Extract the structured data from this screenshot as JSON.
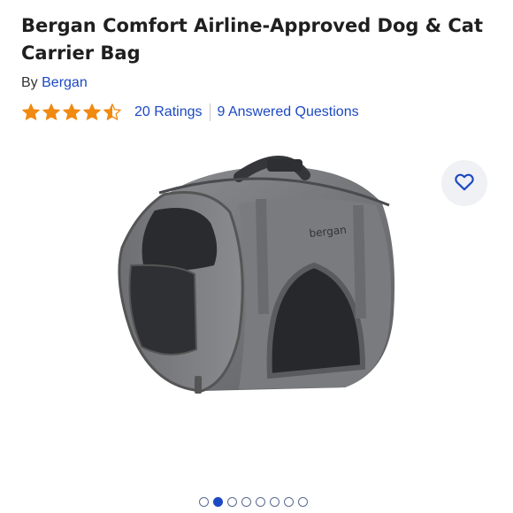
{
  "product": {
    "title": "Bergan Comfort Airline-Approved Dog & Cat Carrier Bag",
    "by_prefix": "By",
    "brand": "Bergan",
    "brand_logo_text": "bergan",
    "rating_value": 4.5,
    "ratings_link": "20 Ratings",
    "questions_link": "9 Answered Questions"
  },
  "icons": {
    "star": "star-icon",
    "favorite": "heart-icon"
  },
  "colors": {
    "star": "#f08a10",
    "link": "#1c49c2",
    "active_dot": "#1c49c2"
  },
  "carousel": {
    "total_images": 8,
    "active_index": 1
  }
}
